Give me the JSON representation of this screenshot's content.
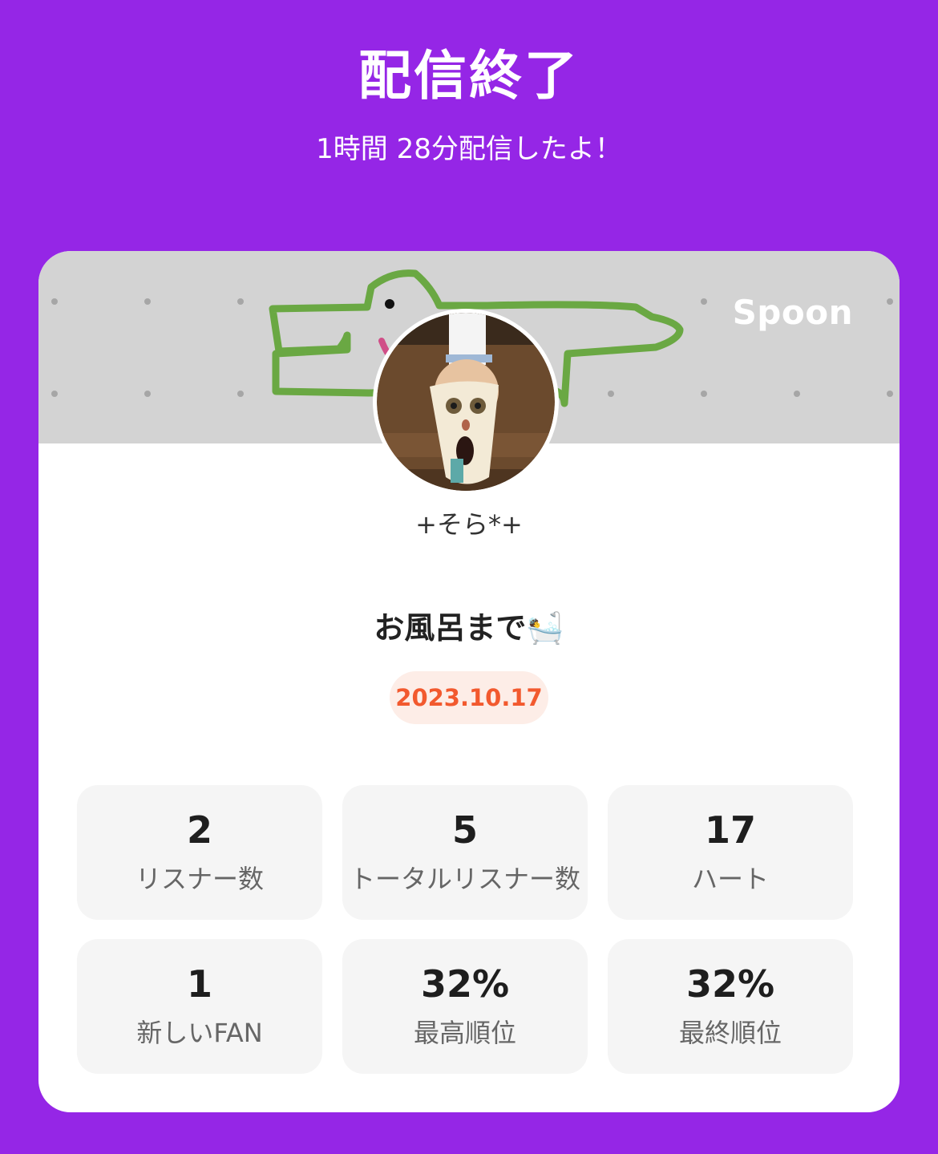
{
  "header": {
    "title": "配信終了",
    "subtitle": "1時間 28分配信したよ！"
  },
  "banner": {
    "brand": "Spoon",
    "background_color": "#D3D3D3",
    "doodle_color": "#6AA843"
  },
  "profile": {
    "nickname": "+そら*+",
    "avatar_icon": "profile-photo"
  },
  "live": {
    "title": "お風呂まで🛀",
    "date": "2023.10.17"
  },
  "stats": [
    {
      "value": "2",
      "label": "リスナー数"
    },
    {
      "value": "5",
      "label": "トータルリスナー数"
    },
    {
      "value": "17",
      "label": "ハート"
    },
    {
      "value": "1",
      "label": "新しいFAN"
    },
    {
      "value": "32%",
      "label": "最高順位"
    },
    {
      "value": "32%",
      "label": "最終順位"
    }
  ],
  "colors": {
    "background": "#9526E6",
    "card": "#FFFFFF",
    "date_text": "#F2592E",
    "date_badge": "#FDEDE7"
  }
}
